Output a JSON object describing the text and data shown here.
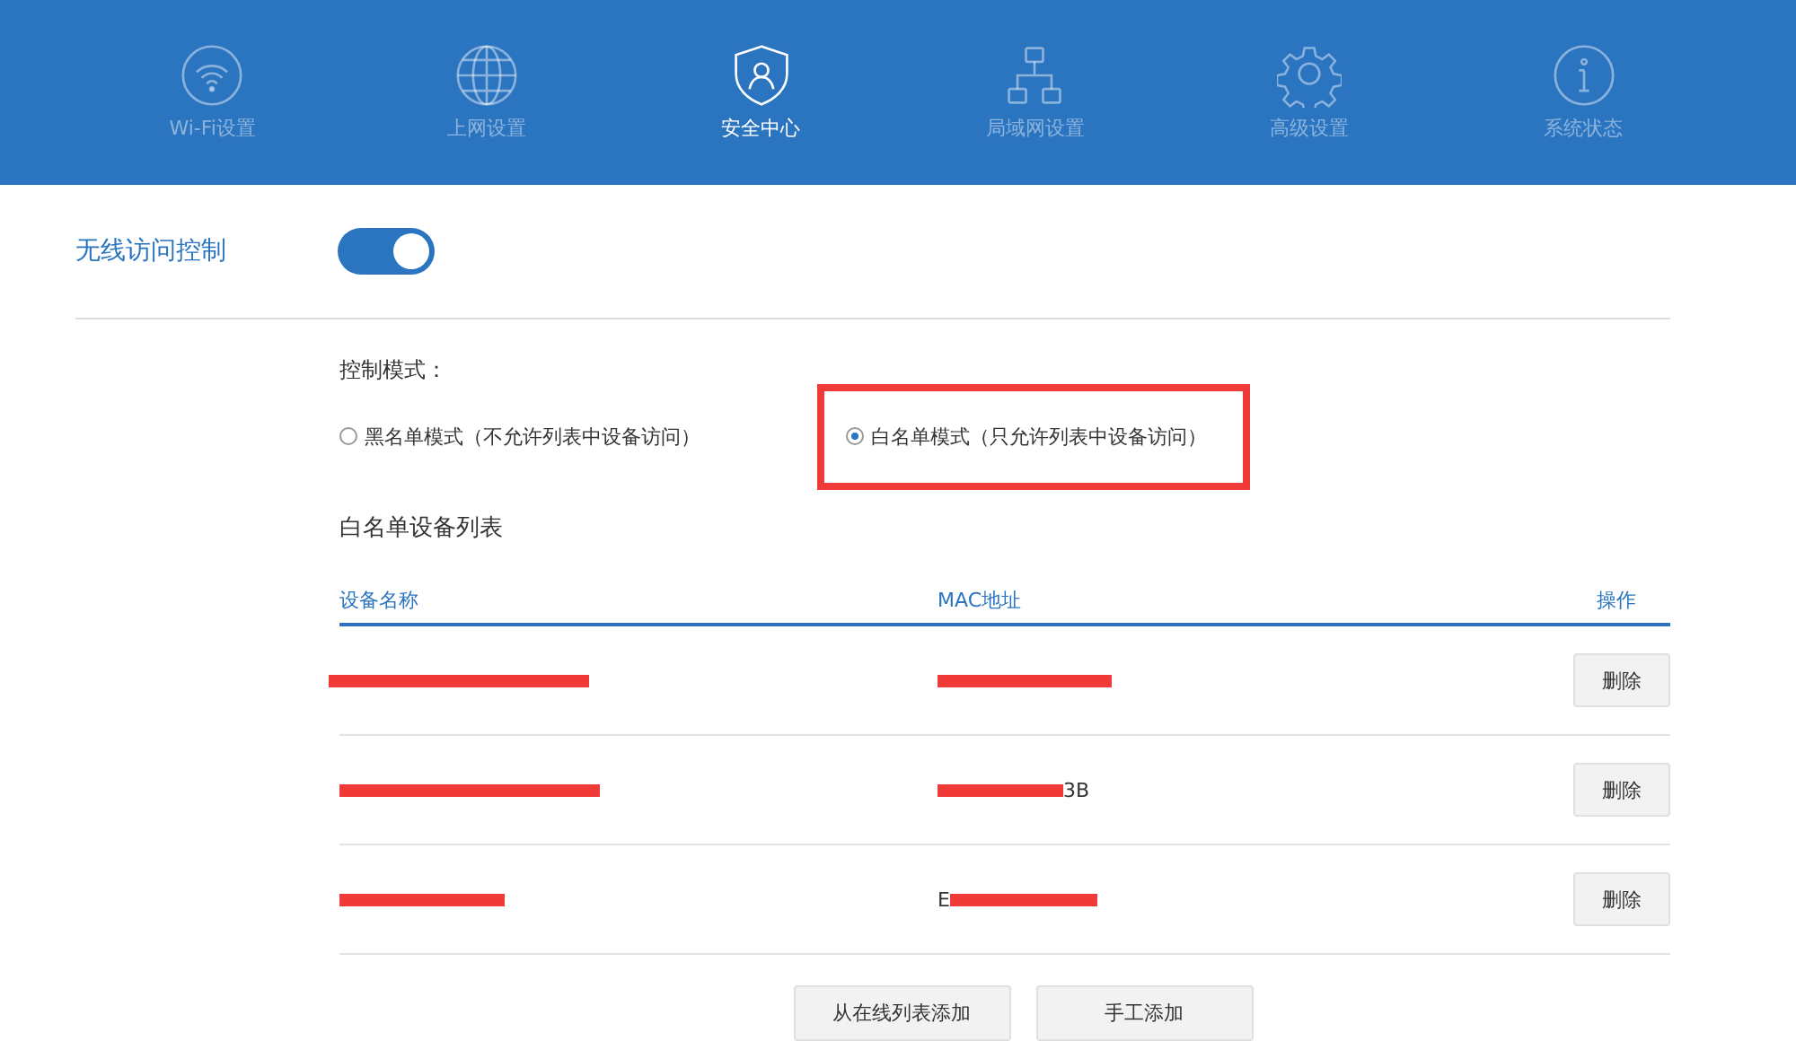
{
  "nav": [
    {
      "label": "Wi-Fi设置",
      "selected": false
    },
    {
      "label": "上网设置",
      "selected": false
    },
    {
      "label": "安全中心",
      "selected": true
    },
    {
      "label": "局域网设置",
      "selected": false
    },
    {
      "label": "高级设置",
      "selected": false
    },
    {
      "label": "系统状态",
      "selected": false
    }
  ],
  "section": {
    "title": "无线访问控制",
    "on": true
  },
  "mode": {
    "label": "控制模式：",
    "options": [
      {
        "label": "黑名单模式（不允许列表中设备访问）",
        "selected": false,
        "highlighted": false
      },
      {
        "label": "白名单模式（只允许列表中设备访问）",
        "selected": true,
        "highlighted": true
      }
    ]
  },
  "list": {
    "title": "白名单设备列表",
    "columns": [
      "设备名称",
      "MAC地址",
      "操作"
    ],
    "rows": [
      {
        "name_redacted": true,
        "mac_redacted": true,
        "action": "删除"
      },
      {
        "name_redacted": true,
        "mac_redacted": true,
        "mac_tail": "3B",
        "action": "删除"
      },
      {
        "name_redacted": true,
        "mac_redacted": true,
        "mac_lead": "E",
        "action": "删除"
      }
    ]
  },
  "buttons": [
    "从在线列表添加",
    "手工添加"
  ]
}
